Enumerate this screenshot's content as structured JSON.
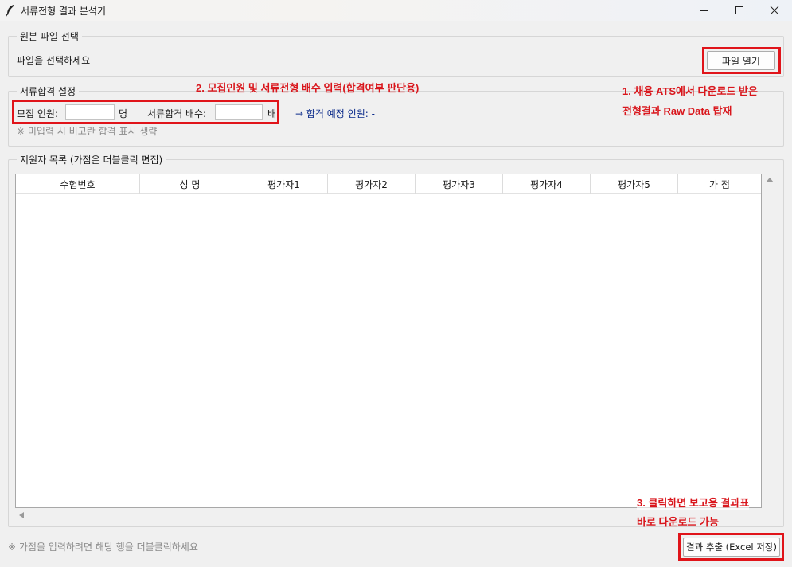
{
  "window": {
    "title": "서류전형 결과 분석기",
    "icon": "feather-icon"
  },
  "file_section": {
    "legend": "원본 파일 선택",
    "status": "파일을 선택하세요",
    "open_button": "파일 열기"
  },
  "pass_section": {
    "legend": "서류합격 설정",
    "recruit_label": "모집 인원:",
    "recruit_value": "",
    "recruit_unit": "명",
    "ratio_label": "서류합격 배수:",
    "ratio_value": "",
    "ratio_unit": "배",
    "expected_label": "→ 합격 예정 인원: -",
    "note": "※ 미입력 시 비고란 합격 표시 생략"
  },
  "list_section": {
    "legend": "지원자 목록 (가점은 더블클릭 편집)",
    "columns": [
      "수험번호",
      "성 명",
      "평가자1",
      "평가자2",
      "평가자3",
      "평가자4",
      "평가자5",
      "가 점"
    ]
  },
  "footer": {
    "hint": "※ 가점을 입력하려면 해당 행을 더블클릭하세요",
    "export_button": "결과 추출 (Excel 저장)"
  },
  "annotations": {
    "step1_line1": "1. 채용 ATS에서 다운로드 받은",
    "step1_line2": "전형결과 Raw Data 탑재",
    "step2": "2. 모집인원 및 서류전형 배수 입력(합격여부 판단용)",
    "step3_line1": "3. 클릭하면 보고용 결과표",
    "step3_line2": "바로 다운로드 가능",
    "color": "#e0141a"
  }
}
